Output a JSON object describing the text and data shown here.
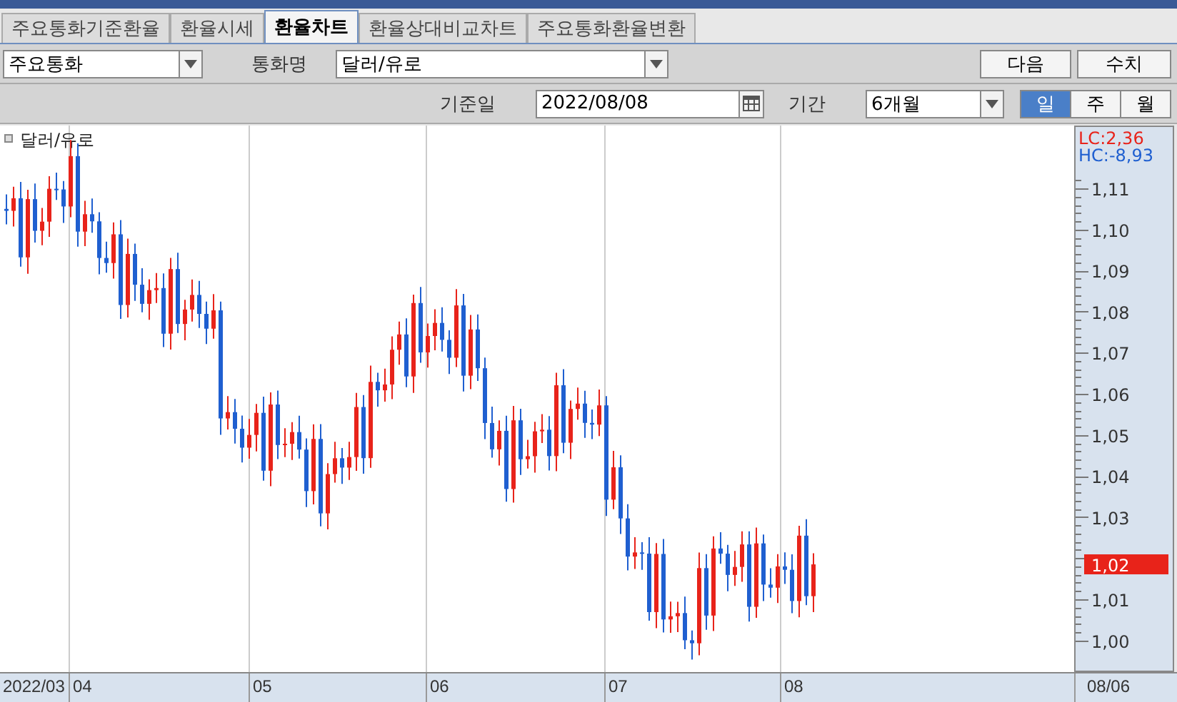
{
  "tabs": [
    {
      "label": "주요통화기준환율",
      "selected": false
    },
    {
      "label": "환율시세",
      "selected": false
    },
    {
      "label": "환율차트",
      "selected": true
    },
    {
      "label": "환율상대비교차트",
      "selected": false
    },
    {
      "label": "주요통화환율변환",
      "selected": false
    }
  ],
  "currency_group": {
    "value": "주요통화"
  },
  "currency_name": {
    "label": "통화명",
    "value": "달러/유로"
  },
  "buttons": [
    "다음",
    "수치"
  ],
  "base_date": {
    "label": "기준일",
    "value": "2022/08/08"
  },
  "period": {
    "label": "기간",
    "value": "6개월"
  },
  "interval_buttons": [
    {
      "label": "일",
      "selected": true
    },
    {
      "label": "주",
      "selected": false
    },
    {
      "label": "월",
      "selected": false
    }
  ],
  "chart": {
    "legend": "달러/유로",
    "lc": "LC:2,36",
    "hc": "HC:-8,93",
    "y_ticks_upper": [
      "1,11",
      "1,10",
      "1,09",
      "1,08",
      "1,07",
      "1,06",
      "1,05",
      "1,04",
      "1,03"
    ],
    "y_ticks_lower": [
      "1,01",
      "1,00"
    ],
    "current_price": "1,02",
    "x_labels": [
      "2022/03",
      "04",
      "05",
      "06",
      "07",
      "08"
    ],
    "end_label": "08/06"
  }
}
